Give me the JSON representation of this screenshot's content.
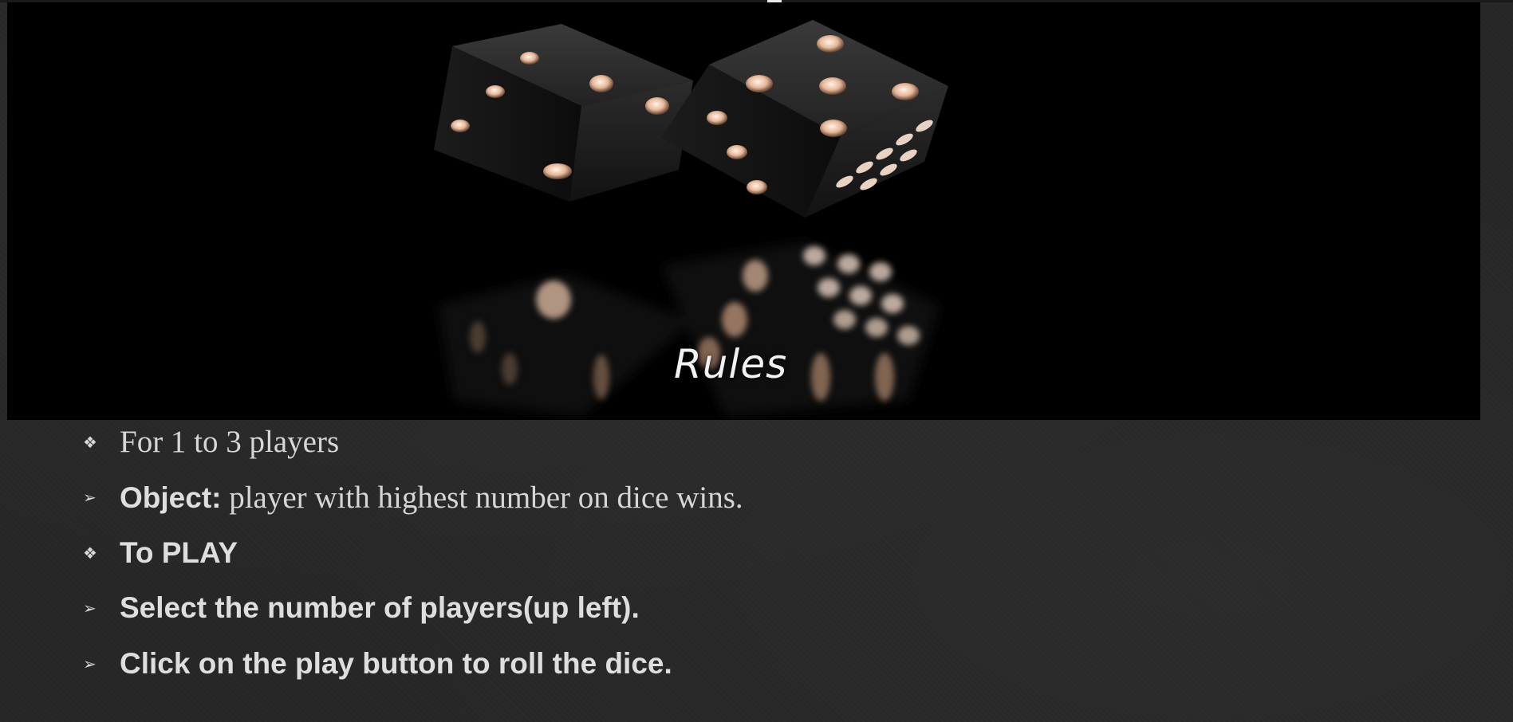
{
  "banner": {
    "title": "Rules"
  },
  "rules": [
    {
      "bullet": "❖",
      "bullet_icon": "diamond-bullet-icon",
      "lead": "",
      "text": "For 1 to 3 players"
    },
    {
      "bullet": "➢",
      "bullet_icon": "arrow-bullet-icon",
      "lead": "Object:",
      "text": " player with highest number on dice wins."
    },
    {
      "bullet": "❖",
      "bullet_icon": "diamond-bullet-icon",
      "lead": "To PLAY",
      "text": ""
    },
    {
      "bullet": "➢",
      "bullet_icon": "arrow-bullet-icon",
      "lead": "Select the number of players(up left).",
      "text": ""
    },
    {
      "bullet": "➢",
      "bullet_icon": "arrow-bullet-icon",
      "lead": "Click on the play button to roll the dice.",
      "text": ""
    }
  ],
  "colors": {
    "background": "#262626",
    "banner": "#000000",
    "text": "#dcdcdc",
    "pip": "#e6b89a"
  }
}
